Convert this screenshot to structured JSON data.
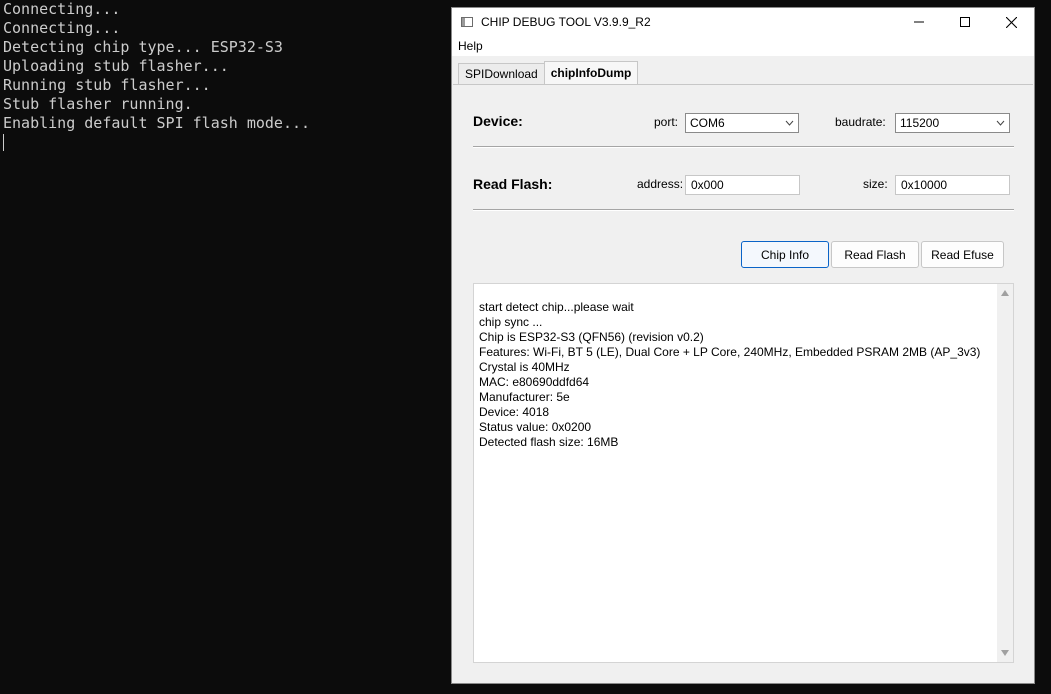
{
  "console": {
    "lines": [
      "Connecting...",
      "Connecting...",
      "Detecting chip type... ESP32-S3",
      "Uploading stub flasher...",
      "Running stub flasher...",
      "Stub flasher running.",
      "Enabling default SPI flash mode..."
    ]
  },
  "window": {
    "title": "CHIP DEBUG TOOL V3.9.9_R2",
    "menu": [
      "Help"
    ],
    "tabs": [
      {
        "label": "SPIDownload",
        "active": false
      },
      {
        "label": "chipInfoDump",
        "active": true
      }
    ]
  },
  "device": {
    "section_label": "Device:",
    "port_label": "port:",
    "port_value": "COM6",
    "baud_label": "baudrate:",
    "baud_value": "115200"
  },
  "read_flash": {
    "section_label": "Read Flash:",
    "address_label": "address:",
    "address_value": "0x000",
    "size_label": "size:",
    "size_value": "0x10000"
  },
  "buttons": {
    "chip_info": "Chip Info",
    "read_flash": "Read Flash",
    "read_efuse": "Read Efuse"
  },
  "log": {
    "lines": [
      "start detect chip...please wait",
      "chip sync ...",
      "Chip is ESP32-S3 (QFN56) (revision v0.2)",
      "Features: Wi-Fi, BT 5 (LE), Dual Core + LP Core, 240MHz, Embedded PSRAM 2MB (AP_3v3)",
      "Crystal is 40MHz",
      "MAC: e80690ddfd64",
      "Manufacturer: 5e",
      "Device: 4018",
      "Status value: 0x0200",
      "Detected flash size: 16MB"
    ]
  },
  "icons": {
    "app": "app-window-icon",
    "minimize": "minimize-icon",
    "maximize": "maximize-icon",
    "close": "close-icon"
  }
}
